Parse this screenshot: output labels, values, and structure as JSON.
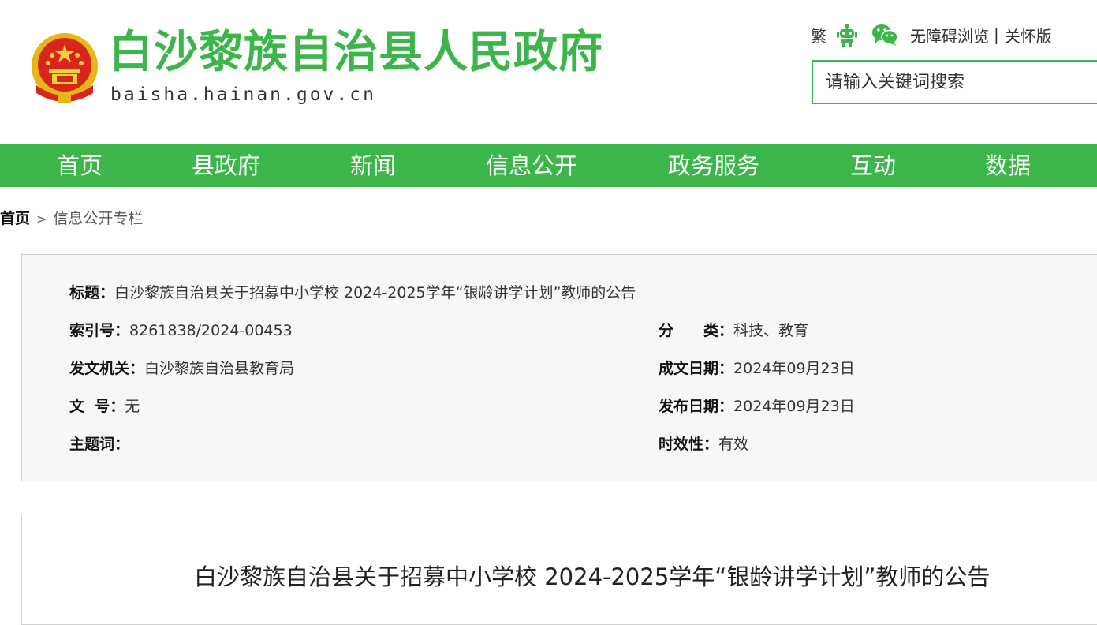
{
  "header": {
    "site_title": "白沙黎族自治县人民政府",
    "domain": "baisha.hainan.gov.cn",
    "traditional_label": "繁",
    "accessibility_label": "无障碍浏览",
    "separator": "|",
    "elderly_label": "关怀版",
    "search_placeholder": "请输入关键词搜索",
    "brand_color": "#3cb64a"
  },
  "nav": {
    "items": [
      {
        "label": "首页"
      },
      {
        "label": "县政府"
      },
      {
        "label": "新闻"
      },
      {
        "label": "信息公开"
      },
      {
        "label": "政务服务"
      },
      {
        "label": "互动"
      },
      {
        "label": "数据"
      }
    ]
  },
  "breadcrumb": {
    "home": "首页",
    "separator": ">",
    "current": "信息公开专栏"
  },
  "meta": {
    "title_label": "标题：",
    "title_value": "白沙黎族自治县关于招募中小学校 2024-2025学年“银龄讲学计划”教师的公告",
    "index_label": "索引号：",
    "index_value": "8261838/2024-00453",
    "category_label": "分　　类：",
    "category_value": "科技、教育",
    "issuer_label": "发文机关：",
    "issuer_value": "白沙黎族自治县教育局",
    "created_label": "成文日期：",
    "created_value": "2024年09月23日",
    "docno_label": "文  号：",
    "docno_value": "无",
    "published_label": "发布日期：",
    "published_value": "2024年09月23日",
    "keywords_label": "主题词：",
    "keywords_value": "",
    "validity_label": "时效性：",
    "validity_value": "有效"
  },
  "article": {
    "title": "白沙黎族自治县关于招募中小学校 2024-2025学年“银龄讲学计划”教师的公告"
  },
  "icons": {
    "accessibility": "robot-accessibility-icon",
    "wechat": "wechat-icon",
    "emblem": "national-emblem-icon"
  }
}
